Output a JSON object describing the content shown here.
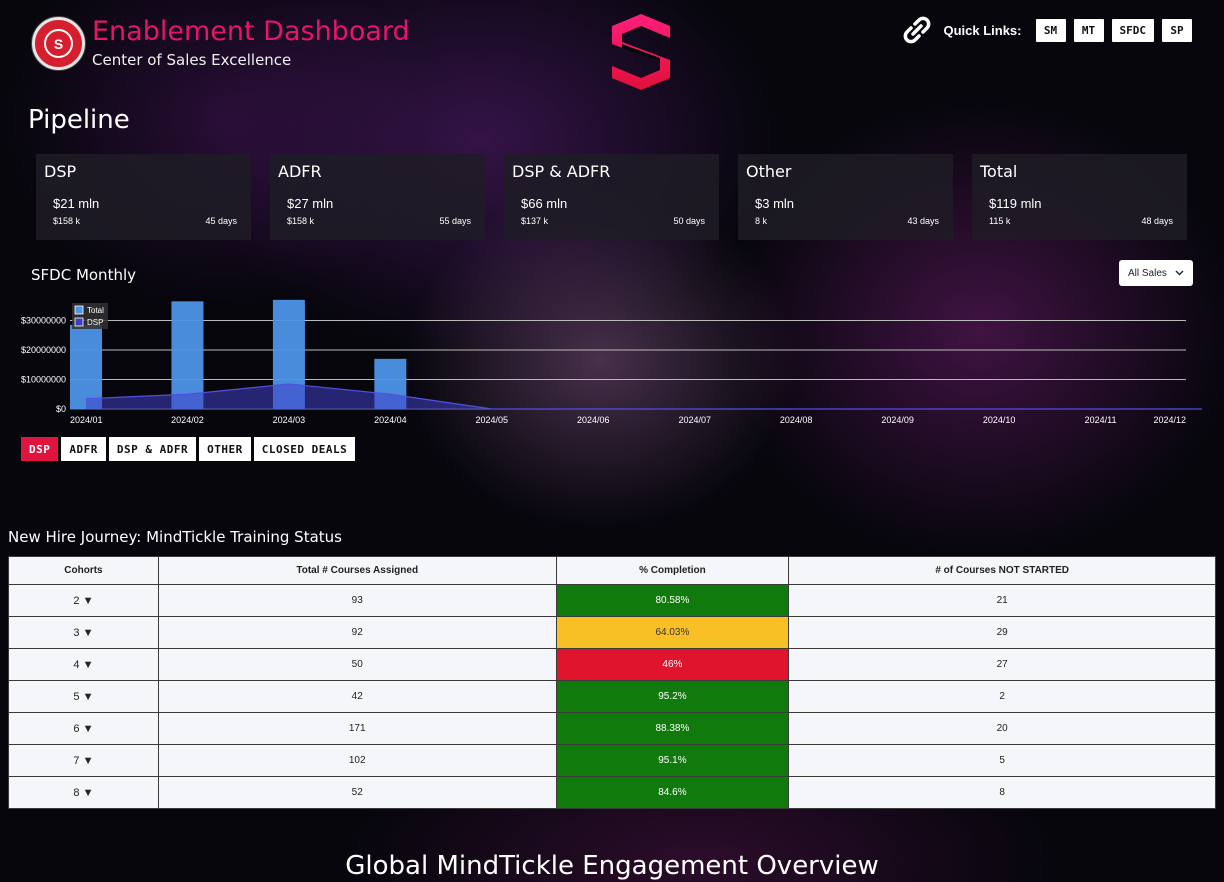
{
  "header": {
    "title": "Enablement Dashboard",
    "subtitle": "Center of Sales Excellence",
    "quick_links_label": "Quick Links:",
    "quick_links": [
      "SM",
      "MT",
      "SFDC",
      "SP"
    ]
  },
  "pipeline": {
    "title": "Pipeline",
    "cards": [
      {
        "title": "DSP",
        "value": "$21 mln",
        "sub": "$158 k",
        "days": "45 days"
      },
      {
        "title": "ADFR",
        "value": "$27 mln",
        "sub": "$158 k",
        "days": "55 days"
      },
      {
        "title": "DSP & ADFR",
        "value": "$66 mln",
        "sub": "$137 k",
        "days": "50 days"
      },
      {
        "title": "Other",
        "value": "$3 mln",
        "sub": "8 k",
        "days": "43 days"
      },
      {
        "title": "Total",
        "value": "$119 mln",
        "sub": "115 k",
        "days": "48 days"
      }
    ]
  },
  "sfdc": {
    "title": "SFDC Monthly",
    "select_value": "All Sales",
    "filters": [
      "DSP",
      "ADFR",
      "DSP & ADFR",
      "OTHER",
      "CLOSED DEALS"
    ],
    "active_filter": "DSP"
  },
  "chart_data": {
    "type": "bar",
    "categories": [
      "2024/01",
      "2024/02",
      "2024/03",
      "2024/04",
      "2024/05",
      "2024/06",
      "2024/07",
      "2024/08",
      "2024/09",
      "2024/10",
      "2024/11",
      "2024/12"
    ],
    "series": [
      {
        "name": "Total",
        "type": "bar",
        "color": "#4e94e8",
        "values": [
          28500000,
          36500000,
          37000000,
          17000000,
          0,
          0,
          0,
          0,
          0,
          0,
          0,
          0
        ]
      },
      {
        "name": "DSP",
        "type": "area",
        "color": "#3f3fc6",
        "values": [
          3500000,
          5000000,
          8500000,
          5000000,
          0,
          0,
          0,
          0,
          0,
          0,
          0,
          0
        ]
      }
    ],
    "yticks": [
      "$0",
      "$10000000",
      "$20000000",
      "$30000000"
    ],
    "ylim": [
      0,
      40000000
    ],
    "legend_position": "top-left",
    "grid": true
  },
  "training": {
    "title": "New Hire Journey: MindTickle Training Status",
    "columns": [
      "Cohorts",
      "Total # Courses Assigned",
      "% Completion",
      "# of Courses NOT STARTED"
    ],
    "rows": [
      {
        "cohort": "2 ▼",
        "assigned": "93",
        "completion": "80.58%",
        "not_started": "21",
        "status": "green"
      },
      {
        "cohort": "3 ▼",
        "assigned": "92",
        "completion": "64.03%",
        "not_started": "29",
        "status": "yellow"
      },
      {
        "cohort": "4 ▼",
        "assigned": "50",
        "completion": "46%",
        "not_started": "27",
        "status": "red"
      },
      {
        "cohort": "5 ▼",
        "assigned": "42",
        "completion": "95.2%",
        "not_started": "2",
        "status": "green"
      },
      {
        "cohort": "6 ▼",
        "assigned": "171",
        "completion": "88.38%",
        "not_started": "20",
        "status": "green"
      },
      {
        "cohort": "7 ▼",
        "assigned": "102",
        "completion": "95.1%",
        "not_started": "5",
        "status": "green"
      },
      {
        "cohort": "8 ▼",
        "assigned": "52",
        "completion": "84.6%",
        "not_started": "8",
        "status": "green"
      }
    ]
  },
  "overview": {
    "title": "Global MindTickle Engagement Overview"
  }
}
